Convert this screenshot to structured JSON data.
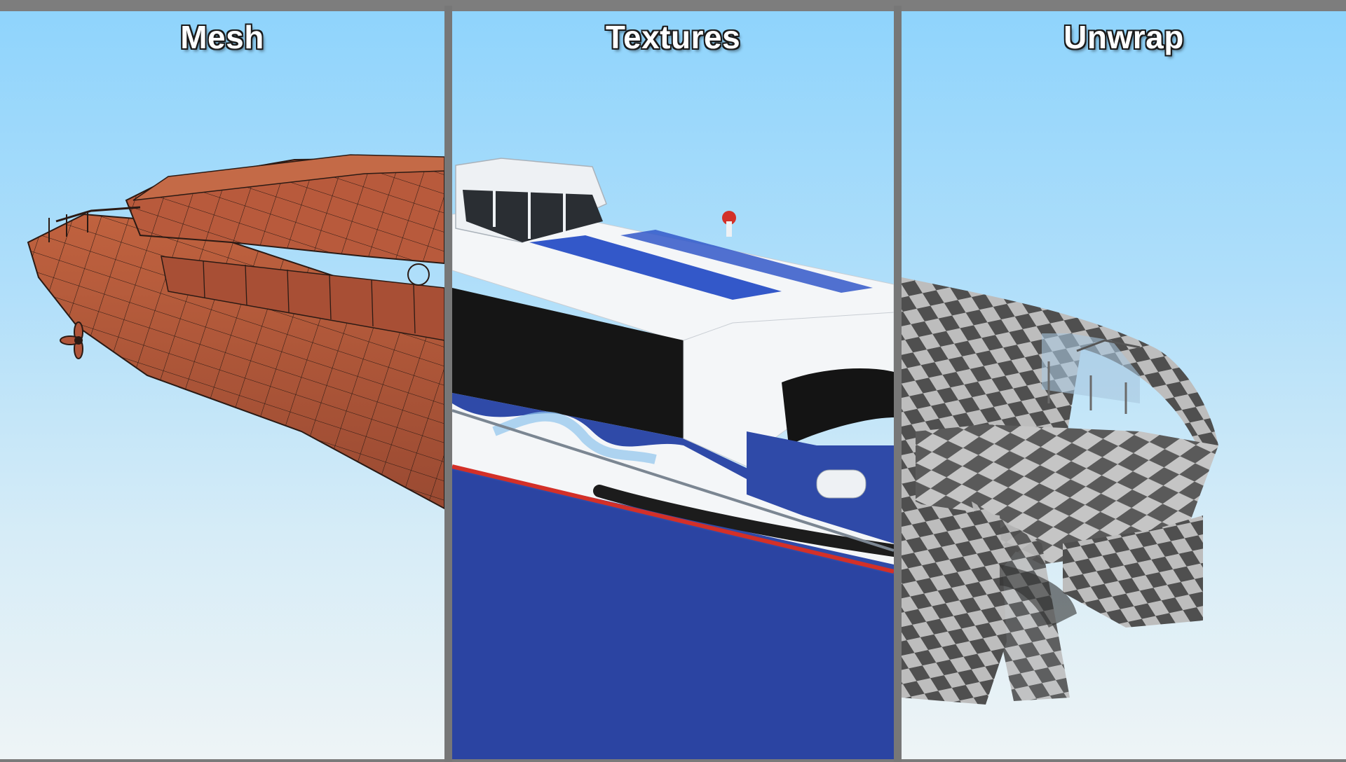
{
  "panels": [
    {
      "id": "mesh",
      "title": "Mesh"
    },
    {
      "id": "textures",
      "title": "Textures"
    },
    {
      "id": "unwrap",
      "title": "Unwrap"
    }
  ],
  "colors": {
    "sky_top": "#8fd4fc",
    "sky_bottom": "#eef4f6",
    "mesh_hull": "#b0553a",
    "mesh_wire": "#2b1a14",
    "livery_blue": "#2f4aa8",
    "livery_red": "#d33028",
    "deck_white": "#f4f6f8",
    "window_black": "#141414",
    "checker_dark": "#4f4f4f",
    "checker_light": "#bdbdbd",
    "divider": "#777777"
  }
}
